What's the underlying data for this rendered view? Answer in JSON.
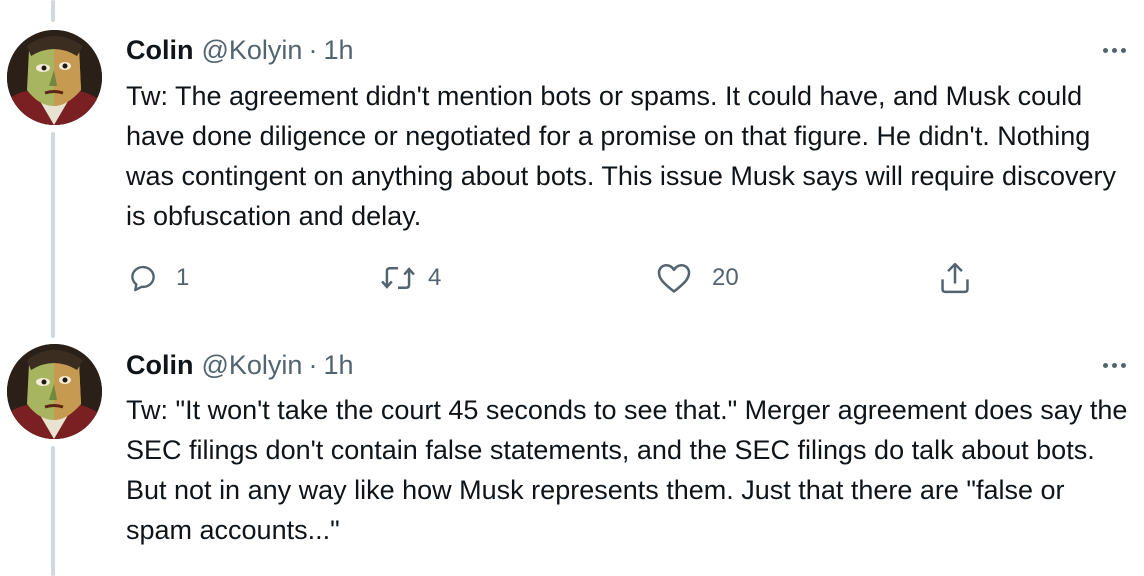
{
  "tweets": [
    {
      "author_name": "Colin",
      "author_handle": "@Kolyin",
      "separator": "·",
      "time": "1h",
      "text": "Tw: The agreement didn't mention bots or spams. It could have, and Musk could have done diligence or negotiated for a promise on that figure. He didn't. Nothing was contingent on anything about bots. This issue Musk says will require discovery is obfuscation and delay.",
      "reply_count": "1",
      "retweet_count": "4",
      "like_count": "20"
    },
    {
      "author_name": "Colin",
      "author_handle": "@Kolyin",
      "separator": "·",
      "time": "1h",
      "text": "Tw: \"It won't take the court 45 seconds to see that.\" Merger agreement does say the SEC filings don't contain false statements, and the SEC filings do talk about bots. But not in any way like how Musk represents them. Just that there are \"false or spam accounts...\""
    }
  ],
  "icons": {
    "reply": "reply-icon",
    "retweet": "retweet-icon",
    "like": "heart-icon",
    "share": "share-icon",
    "more": "more-options-icon",
    "avatar": "avatar-cubist-portrait"
  },
  "colors": {
    "text_primary": "#0f1419",
    "text_secondary": "#536471",
    "thread_line": "#cfd9de"
  }
}
